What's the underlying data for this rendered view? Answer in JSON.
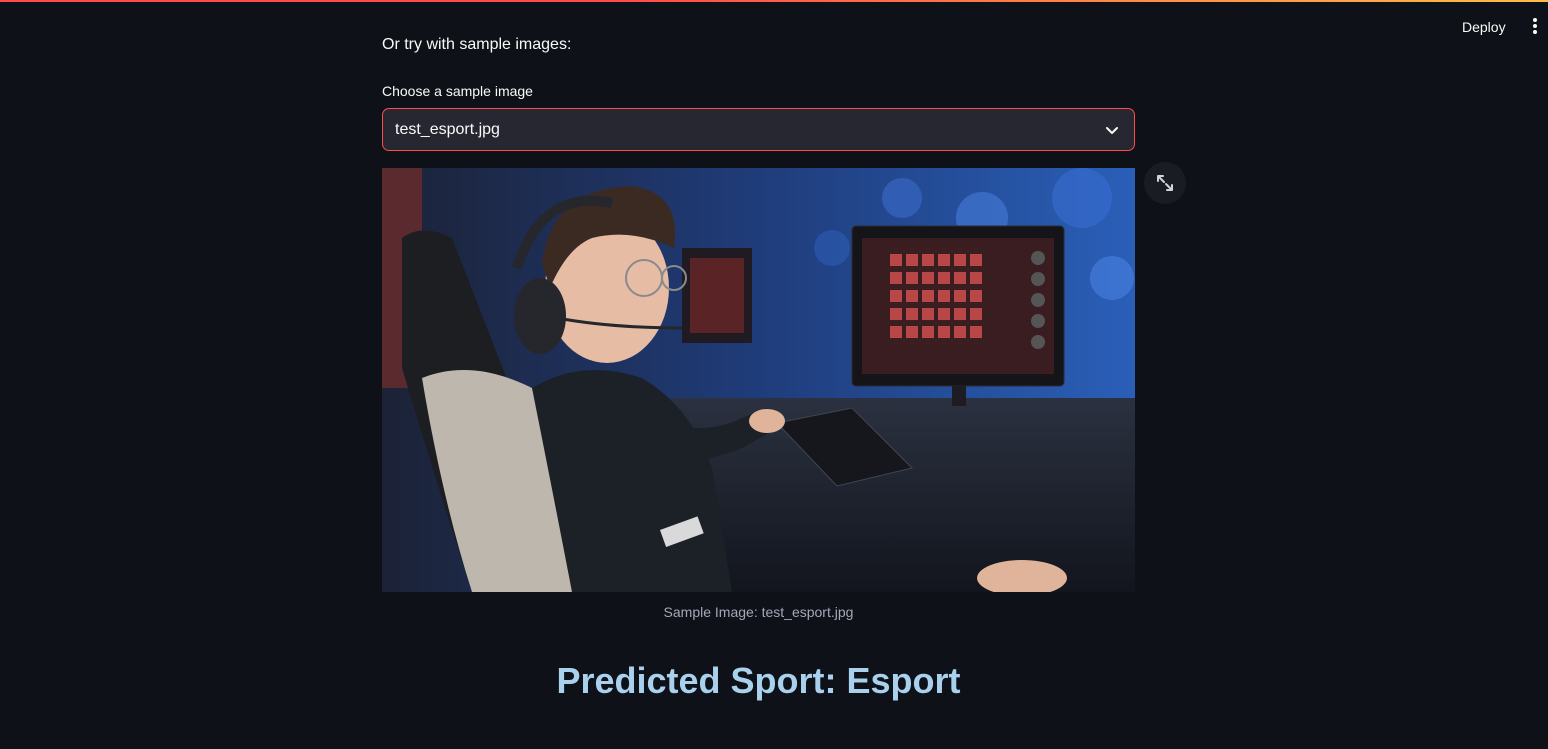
{
  "header": {
    "deploy_label": "Deploy",
    "menu_icon": "vertical-ellipsis-icon"
  },
  "main": {
    "intro_text": "Or try with sample images:",
    "sample_select": {
      "label": "Choose a sample image",
      "value": "test_esport.jpg",
      "icon": "chevron-down-icon"
    },
    "image": {
      "caption": "Sample Image: test_esport.jpg",
      "expand_icon": "fullscreen-icon"
    },
    "prediction": "Predicted Sport: Esport"
  },
  "colors": {
    "background": "#0e1117",
    "select_border": "#ff4b4b",
    "select_bg": "#262730",
    "prediction_text": "#a9d1ee"
  }
}
